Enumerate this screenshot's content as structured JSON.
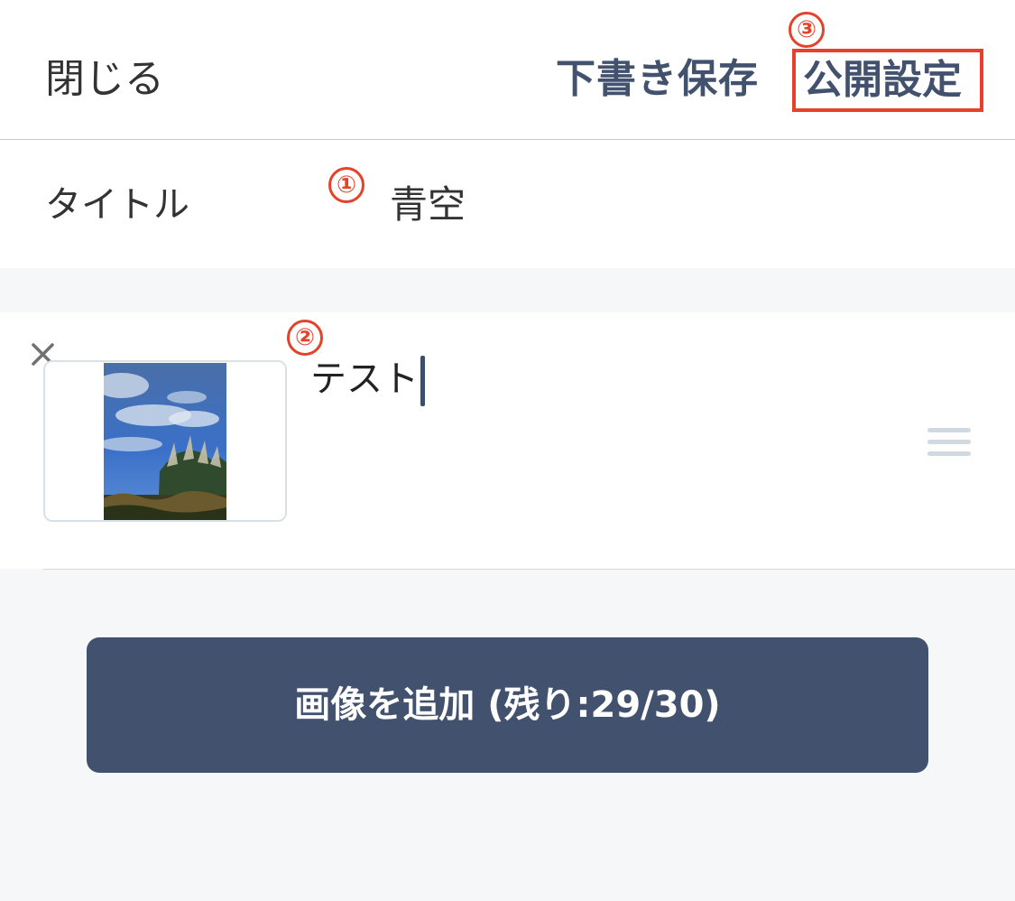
{
  "header": {
    "close_label": "閉じる",
    "draft_label": "下書き保存",
    "publish_label": "公開設定"
  },
  "annotations": {
    "marker_1": "①",
    "marker_2": "②",
    "marker_3": "③",
    "color": "#e4432a"
  },
  "title_row": {
    "label": "タイトル",
    "value": "青空"
  },
  "item": {
    "caption": "テスト",
    "remove_icon": "close-icon",
    "drag_icon": "drag-handle-icon",
    "thumbnail": "sky-photo"
  },
  "add_image_button": {
    "label": "画像を追加 (残り:29/30)"
  },
  "colors": {
    "accent": "#42526e",
    "highlight": "#e4432a",
    "background": "#f6f7f9"
  }
}
